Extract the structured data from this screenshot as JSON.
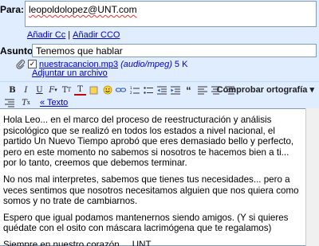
{
  "to": {
    "label": "Para:",
    "value": "leopoldolopez@UNT.com"
  },
  "cc_links": {
    "cc": "Añadir Cc",
    "bcc": "Añadir CCO",
    "separator": "|"
  },
  "subject": {
    "label": "Asunto:",
    "value": "Tenemos que hablar"
  },
  "attachment": {
    "filename": "nuestracancion.mp3",
    "type": "(audio/mpeg)",
    "size": "5 K",
    "checked": true,
    "add_label": "Adjuntar un archivo"
  },
  "toolbar": {
    "spellcheck": "Comprobar ortografía",
    "texto": "« Texto"
  },
  "body": {
    "p1": "Hola Leo... en el marco del proceso de reestructuración y análisis psicológico que se realizó en todos los estados a nivel nacional, el partido Un Nuevo Tiempo aprobó que eres demasiado bello y perfecto, pero en este momento no sabemos si nosotros te hacemos bien a ti... por lo tanto, creemos que debemos terminar.",
    "p2": "No nos mal interpretes, sabemos que tienes tus necesidades... pero a veces sentimos que nosotros necesitamos alguien que nos quiera como somos y no trate de cambiarnos.",
    "p3": "Espero que igual podamos mantenernos siendo amigos. (Y si quieres quédate con el osito con máscara lacrimógena que te regalamos)",
    "p4": "Siempre en nuestro corazón,,,, UNT"
  }
}
